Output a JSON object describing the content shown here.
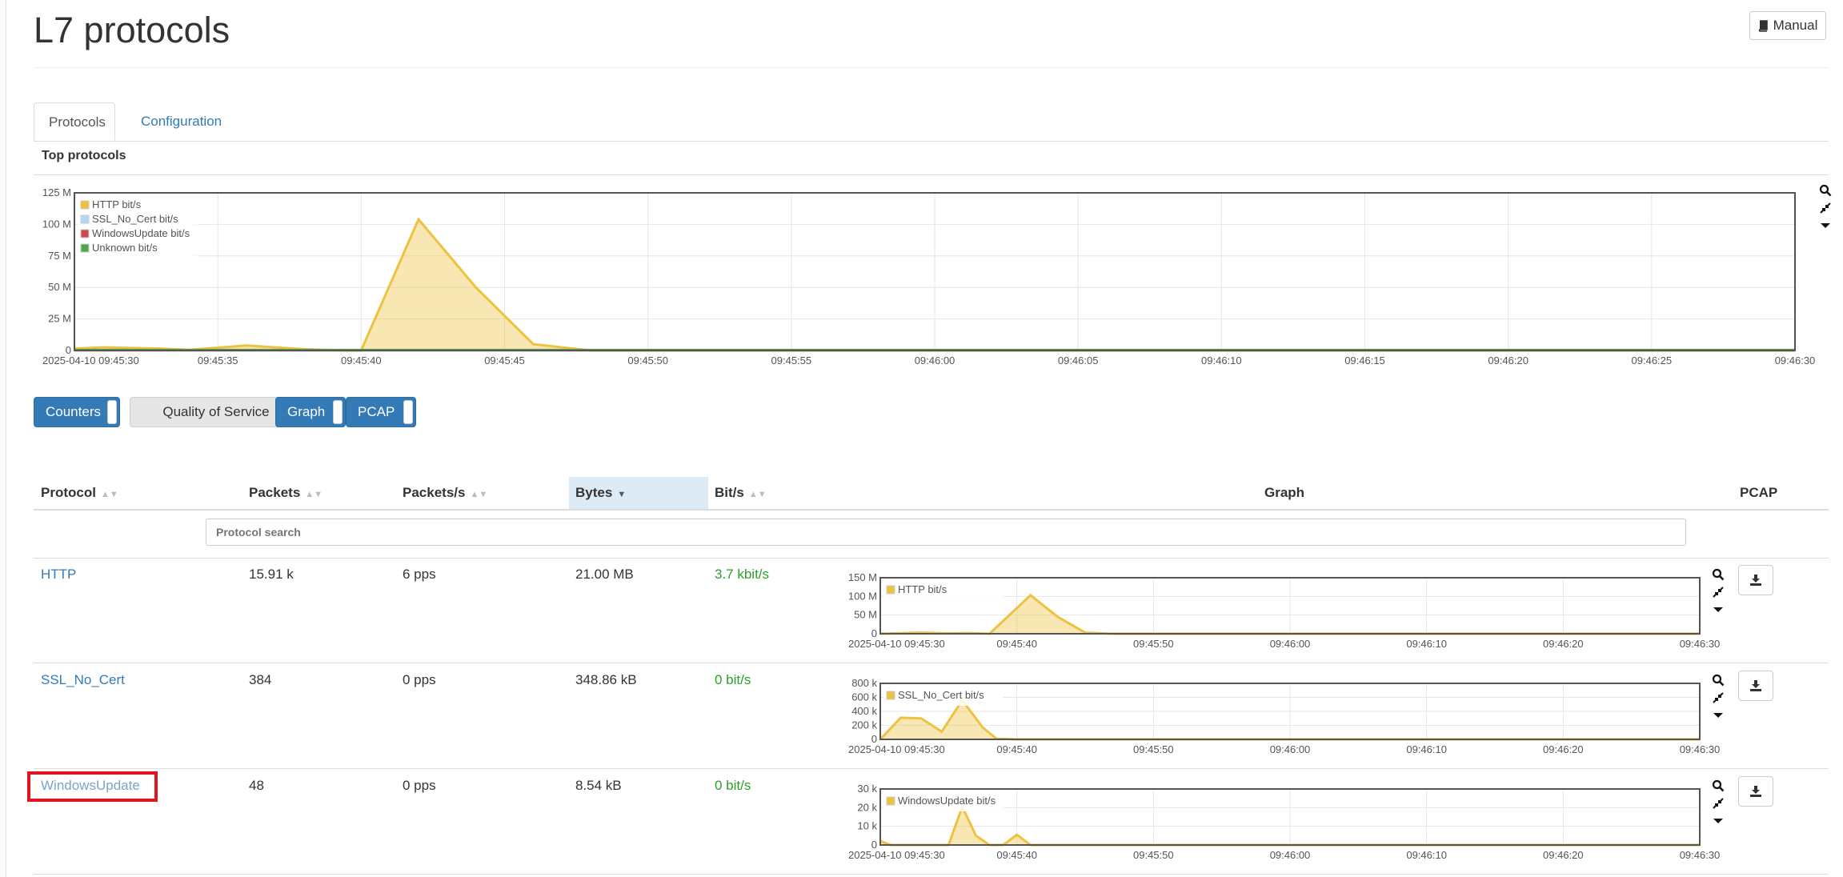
{
  "page": {
    "title": "L7 protocols",
    "manual_label": "Manual"
  },
  "tabs": [
    {
      "label": "Protocols",
      "active": true
    },
    {
      "label": "Configuration",
      "active": false
    }
  ],
  "top_protocols": {
    "title": "Top protocols",
    "chart_data": {
      "type": "area",
      "x_labels": [
        "2025-04-10 09:45:30",
        "09:45:35",
        "09:45:40",
        "09:45:45",
        "09:45:50",
        "09:45:55",
        "09:46:00",
        "09:46:05",
        "09:46:10",
        "09:46:15",
        "09:46:20",
        "09:46:25",
        "09:46:30"
      ],
      "y_labels": [
        "0",
        "25 M",
        "50 M",
        "75 M",
        "100 M",
        "125 M"
      ],
      "ylim": [
        0,
        125000000
      ],
      "xlim_seconds": [
        0,
        60
      ],
      "series": [
        {
          "name": "HTTP bit/s",
          "color": "#edc240",
          "points": [
            [
              0,
              1500000
            ],
            [
              1,
              2500000
            ],
            [
              3,
              1500000
            ],
            [
              4,
              500000
            ],
            [
              6,
              4000000
            ],
            [
              8,
              1000000
            ],
            [
              9.5,
              0
            ],
            [
              10,
              0
            ],
            [
              12,
              104000000
            ],
            [
              14,
              50000000
            ],
            [
              16,
              5000000
            ],
            [
              18,
              0
            ],
            [
              60,
              0
            ]
          ]
        },
        {
          "name": "SSL_No_Cert bit/s",
          "color": "#afd8f8",
          "points": [
            [
              0,
              300000
            ],
            [
              60,
              300000
            ]
          ]
        },
        {
          "name": "WindowsUpdate bit/s",
          "color": "#cb4b4b",
          "points": [
            [
              0,
              100000
            ],
            [
              60,
              100000
            ]
          ]
        },
        {
          "name": "Unknown bit/s",
          "color": "#4da74d",
          "points": [
            [
              0,
              400000
            ],
            [
              60,
              400000
            ]
          ]
        }
      ]
    }
  },
  "toggles": [
    {
      "label": "Counters",
      "on": true
    },
    {
      "label": "Quality of Service",
      "on": false
    },
    {
      "label": "Graph",
      "on": true
    },
    {
      "label": "PCAP",
      "on": true
    }
  ],
  "table": {
    "headers": {
      "protocol": "Protocol",
      "packets": "Packets",
      "packets_s": "Packets/s",
      "bytes": "Bytes",
      "bits_s": "Bit/s",
      "graph": "Graph",
      "pcap": "PCAP"
    },
    "sort_glyph": "▲▼",
    "sort_active_glyph": "▼",
    "search_placeholder": "Protocol search",
    "rows": [
      {
        "protocol": "HTTP",
        "packets": "15.91 k",
        "packets_s": "6 pps",
        "bytes": "21.00 MB",
        "bits_s": "3.7 kbit/s",
        "chart_data": {
          "type": "area",
          "series": [
            {
              "name": "HTTP bit/s",
              "color": "#edc240",
              "points": [
                [
                  0,
                  0
                ],
                [
                  1,
                  1000000
                ],
                [
                  3,
                  3000000
                ],
                [
                  5,
                  1000000
                ],
                [
                  6.5,
                  2000000
                ],
                [
                  8,
                  0
                ],
                [
                  11,
                  103000000
                ],
                [
                  13,
                  45000000
                ],
                [
                  15,
                  3000000
                ],
                [
                  17,
                  0
                ],
                [
                  60,
                  0
                ]
              ]
            }
          ],
          "y_labels": [
            "0",
            "50 M",
            "100 M",
            "150 M"
          ],
          "ylim": [
            0,
            150000000
          ],
          "x_labels": [
            "2025-04-10 09:45:30",
            "09:45:40",
            "09:45:50",
            "09:46:00",
            "09:46:10",
            "09:46:20",
            "09:46:30"
          ],
          "xlim_seconds": [
            0,
            60
          ]
        }
      },
      {
        "protocol": "SSL_No_Cert",
        "packets": "384",
        "packets_s": "0 pps",
        "bytes": "348.86 kB",
        "bits_s": "0 bit/s",
        "chart_data": {
          "type": "area",
          "series": [
            {
              "name": "SSL_No_Cert bit/s",
              "color": "#edc240",
              "points": [
                [
                  0,
                  0
                ],
                [
                  1.5,
                  310000
                ],
                [
                  3,
                  300000
                ],
                [
                  4.5,
                  110000
                ],
                [
                  6,
                  560000
                ],
                [
                  7.5,
                  170000
                ],
                [
                  8.5,
                  10000
                ],
                [
                  10,
                  0
                ],
                [
                  60,
                  0
                ]
              ]
            }
          ],
          "y_labels": [
            "0",
            "200 k",
            "400 k",
            "600 k",
            "800 k"
          ],
          "ylim": [
            0,
            800000
          ],
          "x_labels": [
            "2025-04-10 09:45:30",
            "09:45:40",
            "09:45:50",
            "09:46:00",
            "09:46:10",
            "09:46:20",
            "09:46:30"
          ],
          "xlim_seconds": [
            0,
            60
          ]
        }
      },
      {
        "protocol": "WindowsUpdate",
        "packets": "48",
        "packets_s": "0 pps",
        "bytes": "8.54 kB",
        "bits_s": "0 bit/s",
        "chart_data": {
          "type": "area",
          "series": [
            {
              "name": "WindowsUpdate bit/s",
              "color": "#edc240",
              "points": [
                [
                  0,
                  2000
                ],
                [
                  0.8,
                  0
                ],
                [
                  5,
                  0
                ],
                [
                  6,
                  20500
                ],
                [
                  7,
                  5000
                ],
                [
                  8,
                  0
                ],
                [
                  9,
                  0
                ],
                [
                  10,
                  5500
                ],
                [
                  11,
                  0
                ],
                [
                  60,
                  0
                ]
              ]
            }
          ],
          "y_labels": [
            "0",
            "10 k",
            "20 k",
            "30 k"
          ],
          "ylim": [
            0,
            30000
          ],
          "x_labels": [
            "2025-04-10 09:45:30",
            "09:45:40",
            "09:45:50",
            "09:46:00",
            "09:46:10",
            "09:46:20",
            "09:46:30"
          ],
          "xlim_seconds": [
            0,
            60
          ]
        }
      }
    ]
  },
  "icons": {
    "manual": "book-icon",
    "zoom": "search-icon",
    "reset": "compress-icon",
    "menu": "caret-down-icon",
    "download": "download-icon"
  }
}
